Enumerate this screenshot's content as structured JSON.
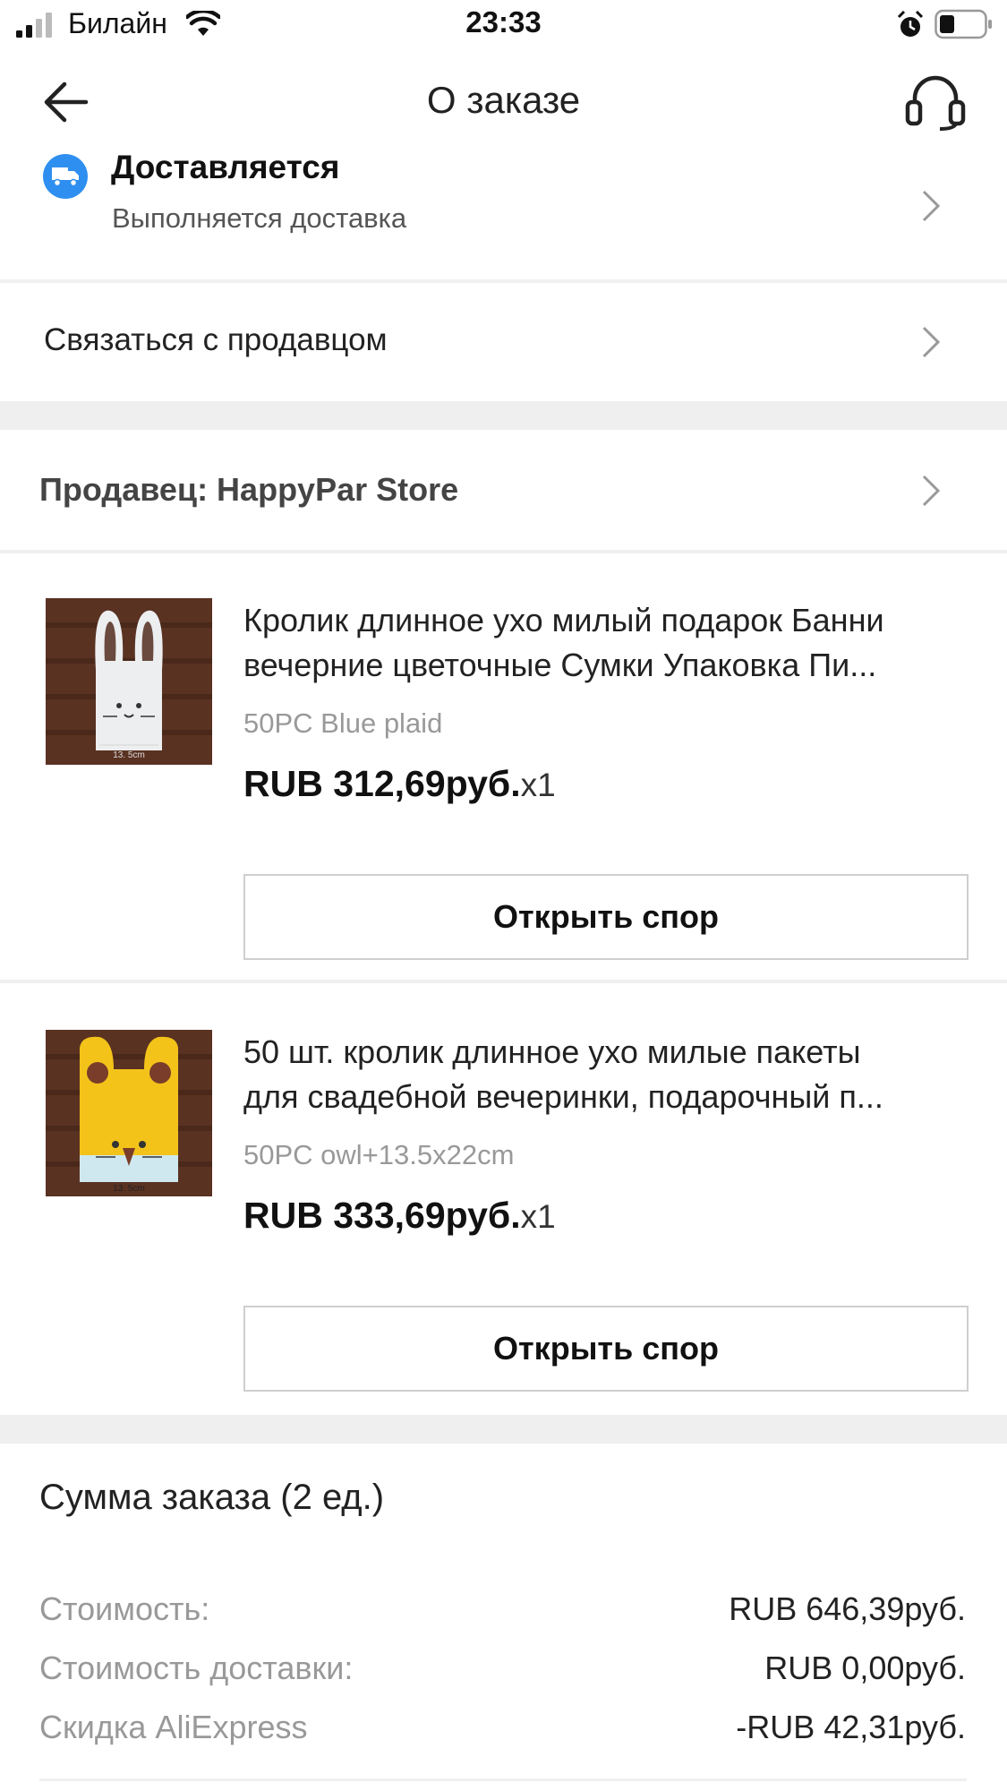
{
  "status_bar": {
    "carrier": "Билайн",
    "time": "23:33",
    "icons": [
      "signal-icon",
      "wifi-icon",
      "alarm-icon",
      "battery-icon"
    ]
  },
  "header": {
    "title": "О заказе",
    "back_icon": "arrow-left-icon",
    "support_icon": "headset-icon"
  },
  "delivery": {
    "title": "Доставляется",
    "subtitle": "Выполняется доставка",
    "icon": "truck-icon"
  },
  "contact_seller": {
    "label": "Связаться с продавцом"
  },
  "seller": {
    "label": "Продавец: HappyPar Store"
  },
  "products": [
    {
      "title_line1": "Кролик длинное ухо милый подарок Банни",
      "title_line2": "вечерние цветочные Сумки Упаковка Пи...",
      "variant": "50PC Blue plaid",
      "price": "RUB 312,69руб.",
      "qty": "x1",
      "image_label": "13. 5cm",
      "button": "Открыть спор"
    },
    {
      "title_line1": "50 шт. кролик длинное ухо милые пакеты",
      "title_line2": "для свадебной вечеринки, подарочный п...",
      "variant": "50PC owl+13.5x22cm",
      "price": "RUB 333,69руб.",
      "qty": "x1",
      "image_label": "13. 5cm",
      "button": "Открыть спор"
    }
  ],
  "summary": {
    "title": "Сумма заказа (2 ед.)",
    "rows": [
      {
        "label": "Стоимость:",
        "value": "RUB 646,39руб."
      },
      {
        "label": "Стоимость доставки:",
        "value": "RUB 0,00руб."
      },
      {
        "label": "Скидка AliExpress",
        "value": "-RUB 42,31руб."
      }
    ]
  },
  "colors": {
    "accent_blue": "#2f8ff0",
    "text_dark": "#222222",
    "text_muted": "#999999",
    "divider": "#efefef"
  }
}
